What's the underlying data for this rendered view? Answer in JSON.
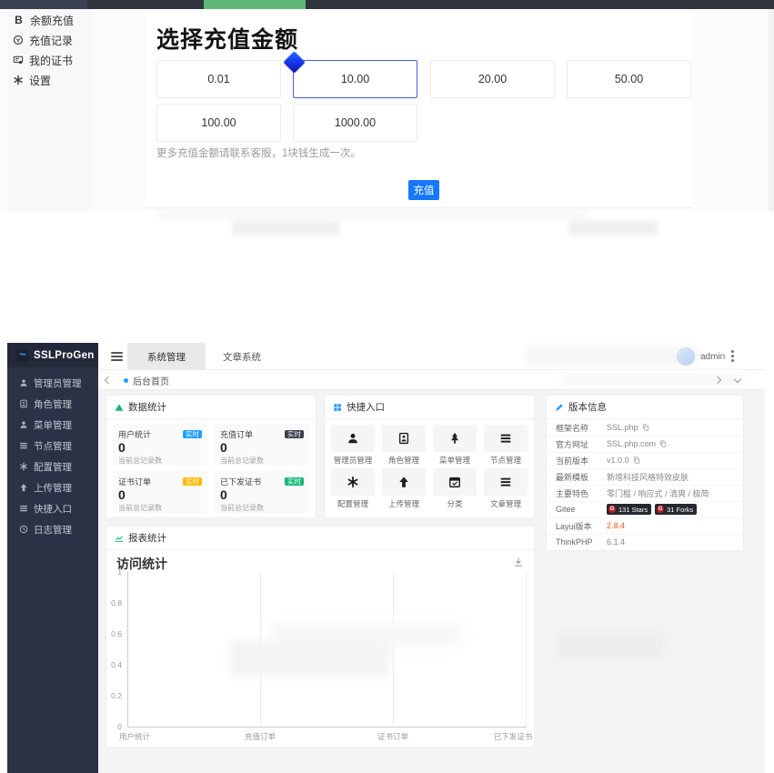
{
  "recharge_app": {
    "sidebar": {
      "items": [
        {
          "icon": "balance-b-icon",
          "glyph": "B",
          "label": "余额充值"
        },
        {
          "icon": "recharge-record-icon",
          "label": "充值记录"
        },
        {
          "icon": "certificate-icon",
          "label": "我的证书"
        },
        {
          "icon": "settings-gear-icon",
          "label": "设置"
        }
      ]
    },
    "page_title": "选择充值金额",
    "amount_options": [
      "0.01",
      "10.00",
      "20.00",
      "50.00",
      "100.00",
      "1000.00"
    ],
    "selected_amount": "10.00",
    "note": "更多充值金额请联系客服，1块钱生成一次。",
    "recharge_button_label": "充值",
    "colors": {
      "accent": "#1677ff",
      "selected_border": "#4a5cd6",
      "topbar": "#30343f",
      "topbar_highlight": "#5FB878"
    }
  },
  "admin_app": {
    "brand": "SSLProGen",
    "header": {
      "tabs": [
        {
          "label": "系统管理",
          "active": true
        },
        {
          "label": "文章系统",
          "active": false
        }
      ],
      "username": "admin"
    },
    "breadcrumb": {
      "label": "后台首页"
    },
    "sidebar": {
      "items": [
        {
          "icon": "admin-user-icon",
          "label": "管理员管理"
        },
        {
          "icon": "role-badge-icon",
          "label": "角色管理"
        },
        {
          "icon": "menu-user-icon",
          "label": "菜单管理"
        },
        {
          "icon": "node-list-icon",
          "label": "节点管理"
        },
        {
          "icon": "config-gear-icon",
          "label": "配置管理"
        },
        {
          "icon": "upload-arrow-icon",
          "label": "上传管理"
        },
        {
          "icon": "shortcut-list-icon",
          "label": "快捷入口"
        },
        {
          "icon": "log-clock-icon",
          "label": "日志管理"
        }
      ]
    },
    "stats_panel": {
      "title": "数据统计",
      "cards": [
        {
          "label": "用户统计",
          "badge": "实时",
          "badge_color": "#1E9FFF",
          "value": "0",
          "sub": "当前总记录数"
        },
        {
          "label": "充值订单",
          "badge": "实时",
          "badge_color": "#393D49",
          "value": "0",
          "sub": "当前总记录数"
        },
        {
          "label": "证书订单",
          "badge": "实时",
          "badge_color": "#FFB800",
          "value": "0",
          "sub": "当前总记录数"
        },
        {
          "label": "已下发证书",
          "badge": "实时",
          "badge_color": "#16b777",
          "value": "0",
          "sub": "当前总记录数"
        }
      ]
    },
    "quick_panel": {
      "title": "快捷入口",
      "items": [
        {
          "icon": "admin-user-icon",
          "label": "管理员管理"
        },
        {
          "icon": "role-badge-icon",
          "label": "角色管理"
        },
        {
          "icon": "menu-tree-icon",
          "label": "菜单管理"
        },
        {
          "icon": "node-list-icon",
          "label": "节点管理"
        },
        {
          "icon": "config-asterisk-icon",
          "label": "配置管理"
        },
        {
          "icon": "upload-arrow-icon",
          "label": "上传管理"
        },
        {
          "icon": "category-calendar-icon",
          "label": "分类"
        },
        {
          "icon": "article-list-icon",
          "label": "文章管理"
        }
      ]
    },
    "version_panel": {
      "title": "版本信息",
      "rows": [
        {
          "label": "框架名称",
          "value": "SSL.php",
          "has_copy_icon": true
        },
        {
          "label": "官方网址",
          "value": "SSL.php.com",
          "has_copy_icon": true
        },
        {
          "label": "当前版本",
          "value": "v1.0.0",
          "has_copy_icon": true
        },
        {
          "label": "最新模板",
          "value": "新增科技风格特效皮肤"
        },
        {
          "label": "主要特色",
          "value": "零门槛 / 响应式 / 清爽 / 极简"
        },
        {
          "label": "Gitee",
          "badges": [
            {
              "label": "131 Stars"
            },
            {
              "label": "31 Forks"
            }
          ]
        },
        {
          "label": "Layui版本",
          "value": "2.8.4",
          "value_color": "#ff5722"
        },
        {
          "label": "ThinkPHP",
          "value": "6.1.4"
        }
      ]
    },
    "report_panel": {
      "title": "报表统计",
      "chart_title": "访问统计"
    }
  },
  "chart_data": {
    "type": "line",
    "title": "访问统计",
    "categories": [
      "用户统计",
      "充值订单",
      "证书订单",
      "已下发证书"
    ],
    "series": [
      {
        "name": "访问统计",
        "values": [
          0,
          0,
          0,
          0
        ]
      }
    ],
    "ylim": [
      0,
      1
    ],
    "yticks": [
      "1",
      "0.8",
      "0.6",
      "0.4",
      "0.2",
      "0"
    ],
    "xlabel": "",
    "ylabel": "",
    "grid": true,
    "legend_position": "none"
  }
}
